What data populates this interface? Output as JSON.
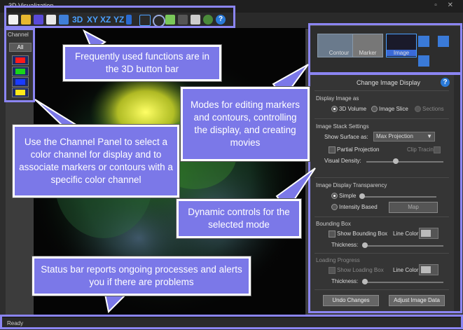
{
  "window": {
    "title": "3D Visualization",
    "controls": "▫ ✕"
  },
  "toolbar": {
    "label_3d": "3D",
    "view_xy": "XY",
    "view_xz": "XZ",
    "view_yz": "YZ",
    "help": "?"
  },
  "channel_panel": {
    "title": "Channel",
    "all_label": "All",
    "channels": [
      "#ff1a1a",
      "#19d419",
      "#1a3bff",
      "#ffe81a"
    ]
  },
  "modes": {
    "contour": "Contour",
    "marker": "Marker",
    "image": "Image"
  },
  "settings": {
    "header": "Change Image Display",
    "display_image_as": "Display Image as",
    "opt_3d_volume": "3D Volume",
    "opt_image_slice": "Image Slice",
    "opt_sections": "Sections",
    "stack_settings": "Image Stack Settings",
    "show_surface_as": "Show Surface as:",
    "surface_value": "Max Projection",
    "partial_projection": "Partial Projection",
    "clip_tracing": "Clip Tracing",
    "visual_density": "Visual Density:",
    "transparency": "Image Display Transparency",
    "simple": "Simple",
    "intensity_based": "Intensity Based",
    "map": "Map",
    "bounding_box": "Bounding Box",
    "show_bounding_box": "Show Bounding Box",
    "line_color": "Line Color:",
    "thickness": "Thickness:",
    "loading_progress": "Loading Progress",
    "show_loading_box": "Show Loading Box",
    "line_color2": "Line Color:",
    "thickness2": "Thickness:",
    "undo": "Undo Changes",
    "adjust": "Adjust Image Data"
  },
  "status": {
    "text": "Ready"
  },
  "callouts": {
    "toolbar": "Frequently used functions are in the 3D button bar",
    "modes": "Modes for editing markers and contours, controlling the display, and creating movies",
    "channel": "Use the Channel Panel to select a color channel for display and to associate markers or contours with a specific color channel",
    "dynamic": "Dynamic controls for the selected mode",
    "status": "Status bar reports ongoing processes and alerts you if there are problems"
  },
  "colors": {
    "accent": "#7b78e8",
    "highlight": "#8b85f2",
    "blue_text": "#4aa0ff"
  }
}
